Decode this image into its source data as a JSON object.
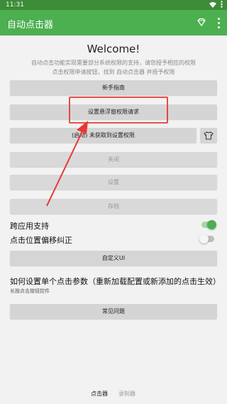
{
  "status_bar": {
    "time": "11:31",
    "icons": [
      "wifi-icon",
      "more-vertical-icon"
    ]
  },
  "app_bar": {
    "title": "自动点击器",
    "icons": [
      "diamond-icon",
      "more-vertical-icon"
    ],
    "colors": {
      "bar": "#4caf50",
      "status": "#3d8c37"
    }
  },
  "main": {
    "welcome": "Welcome!",
    "description_line1": "自动点击功能实现需要部分系统权限的支持，请您授予相应的权限",
    "description_line2": "点击权限申请按钮，找到 自动点击器 并授予权限",
    "buttons": {
      "guide": "新手指南",
      "float_permission": "设置悬浮窗权限请求",
      "accessibility": "(启动) 未获取到设置权限",
      "close": "关闭",
      "settings": "设置",
      "archive": "存档",
      "custom_ui": "自定义UI",
      "faq": "常见问题"
    },
    "switches": {
      "cross_app": {
        "label": "跨应用支持",
        "on": true
      },
      "offset_fix": {
        "label": "点击位置偏移纠正",
        "on": false
      }
    },
    "howto": {
      "title": "如何设置单个点击参数（重新加载配置或新添加的点击生效）",
      "subtitle": "长按点击按钮控件"
    }
  },
  "bottom_nav": {
    "clicker": "点击器",
    "recorder": "录制器",
    "active": "clicker"
  },
  "annotation_color": "#e53935"
}
